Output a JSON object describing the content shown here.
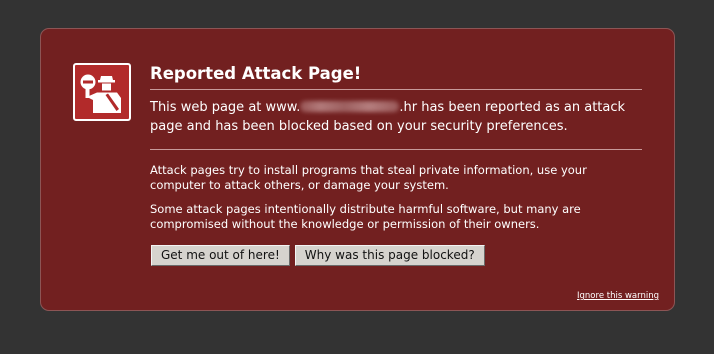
{
  "dialog": {
    "title": "Reported Attack Page!",
    "short_desc_before": "This web page at www.",
    "short_desc_after": ".hr has been reported as an attack page and has been blocked based on your security preferences.",
    "paragraphs": [
      "Attack pages try to install programs that steal private information, use your computer to attack others, or damage your system.",
      "Some attack pages intentionally distribute harmful software, but many are compromised without the knowledge or permission of their owners."
    ],
    "buttons": {
      "get_out": "Get me out of here!",
      "why_blocked": "Why was this page blocked?"
    },
    "ignore_link": "Ignore this warning",
    "icon": "attack-page-policeman-icon"
  },
  "colors": {
    "background": "#333333",
    "panel": "#722020",
    "icon_bg": "#b22a2a",
    "text": "#ffffff",
    "button": "#d6d3ce"
  }
}
